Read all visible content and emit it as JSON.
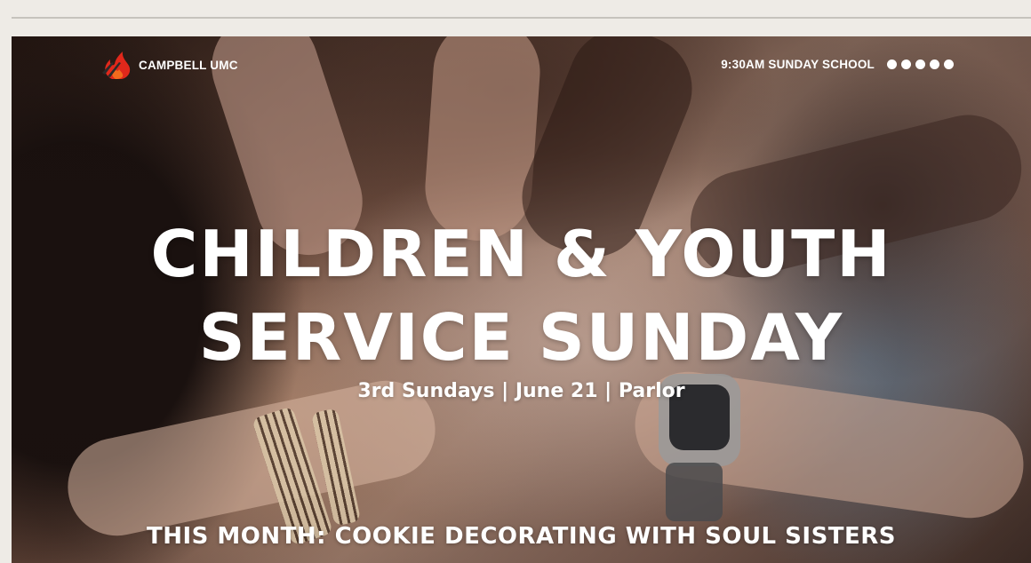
{
  "brand": {
    "name": "CAMPBELL UMC",
    "logo_icon": "cross-flame-logo-icon"
  },
  "nav": {
    "schedule_text": "9:30AM SUNDAY SCHOOL",
    "slide_count": 5,
    "active_slide": 1
  },
  "hero": {
    "title_line1": "CHILDREN & YOUTH",
    "title_line2": "SERVICE SUNDAY",
    "subtitle": "3rd Sundays | June 21 | Parlor",
    "this_month": "THIS MONTH: COOKIE DECORATING WITH SOUL SISTERS"
  },
  "colors": {
    "page_bg": "#eeebe6",
    "logo_red": "#e0281b",
    "logo_dark": "#2a2a2a",
    "text": "#ffffff"
  }
}
